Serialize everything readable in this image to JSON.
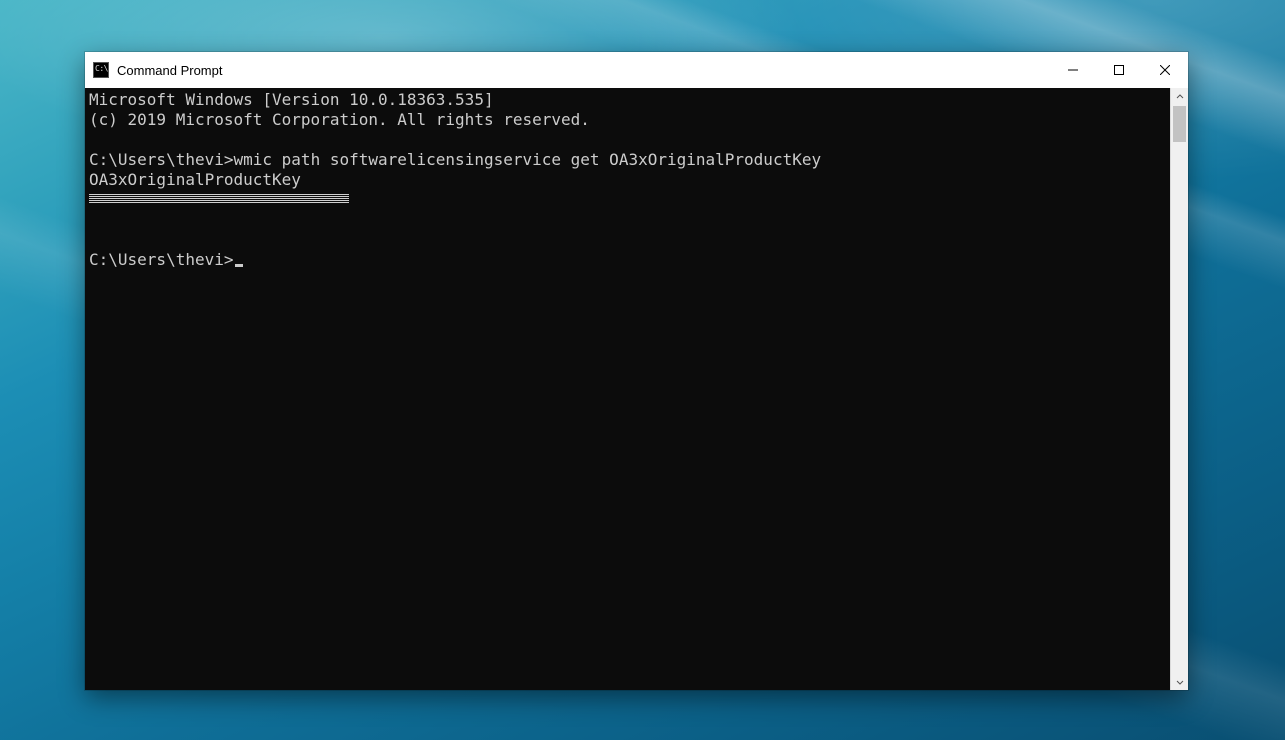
{
  "window": {
    "title": "Command Prompt",
    "icon": "cmd-icon"
  },
  "terminal": {
    "banner_line1": "Microsoft Windows [Version 10.0.18363.535]",
    "banner_line2": "(c) 2019 Microsoft Corporation. All rights reserved.",
    "prompt1_path": "C:\\Users\\thevi>",
    "command1": "wmic path softwarelicensingservice get OA3xOriginalProductKey",
    "output_header": "OA3xOriginalProductKey",
    "output_value_redacted": true,
    "prompt2_path": "C:\\Users\\thevi>",
    "command2": ""
  },
  "controls": {
    "minimize": "minimize",
    "maximize": "maximize",
    "close": "close"
  }
}
